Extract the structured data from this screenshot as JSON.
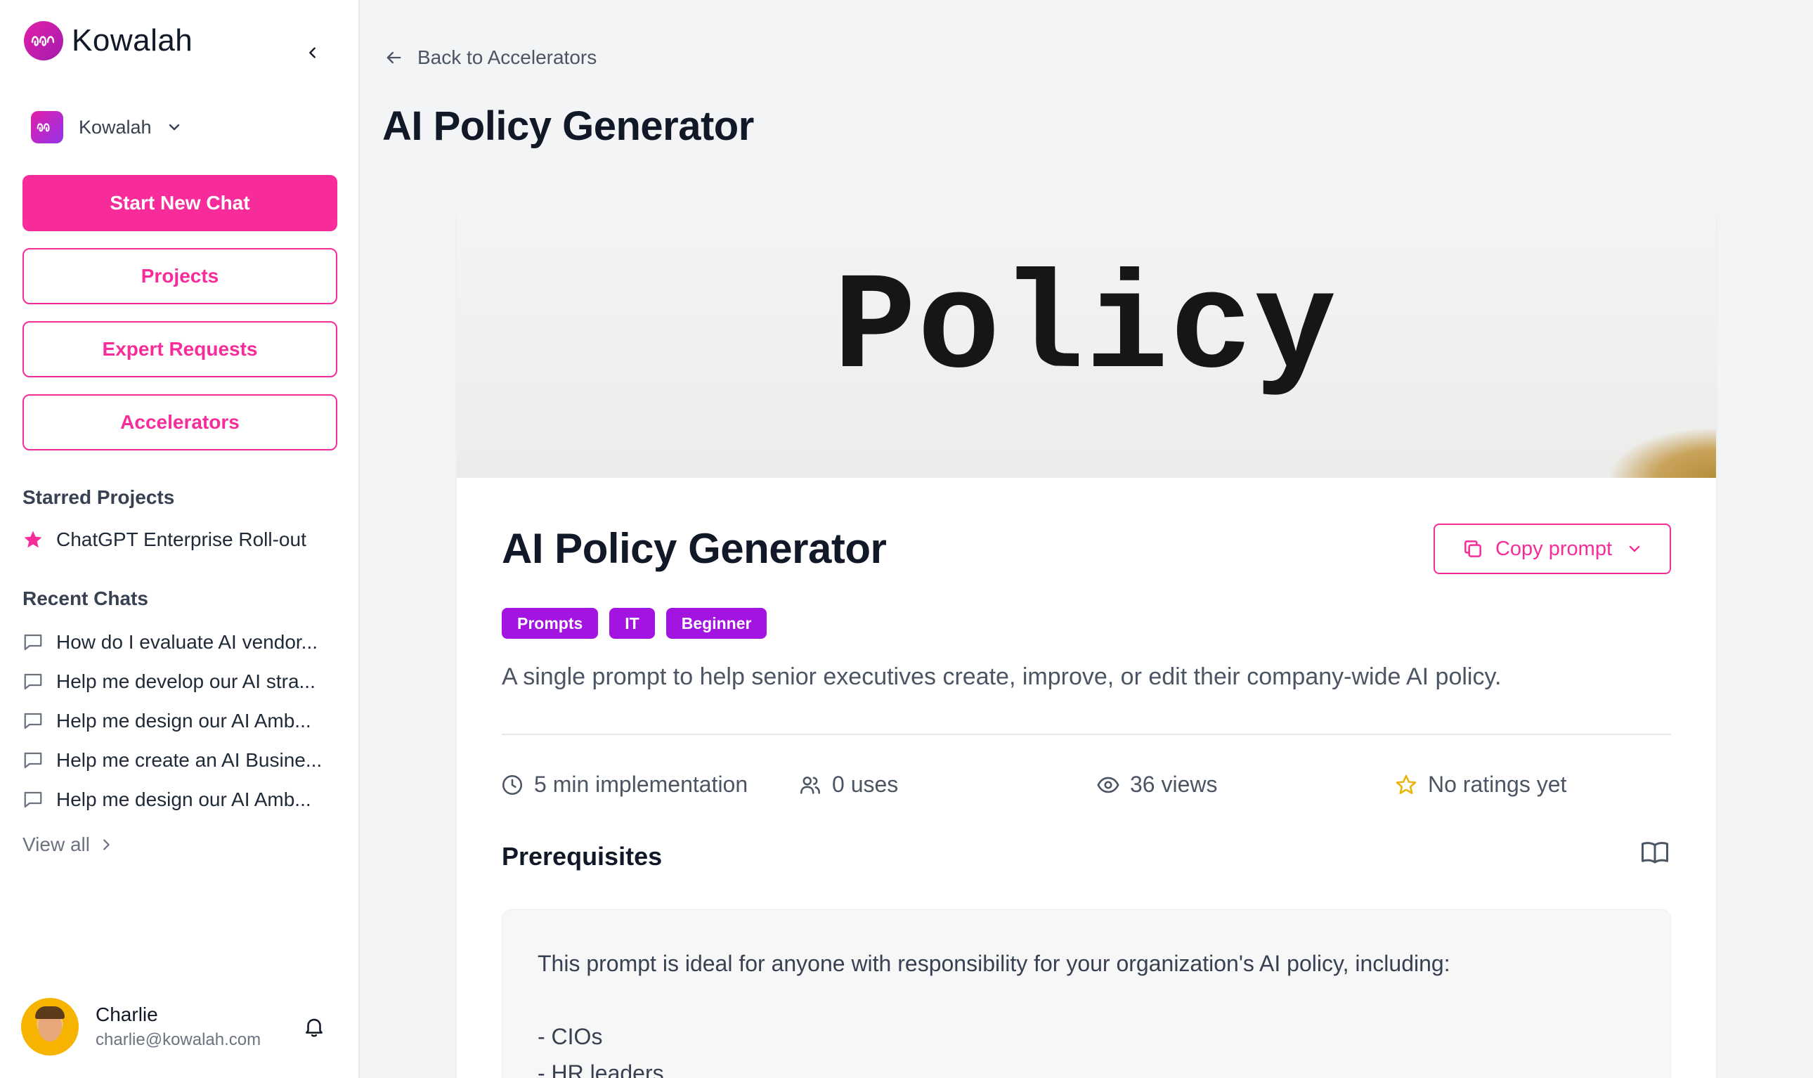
{
  "sidebar": {
    "brand": "Kowalah",
    "org": "Kowalah",
    "buttons": {
      "new_chat": "Start New Chat",
      "projects": "Projects",
      "expert_requests": "Expert Requests",
      "accelerators": "Accelerators"
    },
    "starred_title": "Starred Projects",
    "starred": [
      "ChatGPT Enterprise Roll-out"
    ],
    "recent_title": "Recent Chats",
    "recent": [
      "How do I evaluate AI vendor...",
      "Help me develop our AI stra...",
      "Help me design our AI Amb...",
      "Help me create an AI Busine...",
      "Help me design our AI Amb..."
    ],
    "view_all": "View all",
    "user": {
      "name": "Charlie",
      "email": "charlie@kowalah.com"
    }
  },
  "main": {
    "back_label": "Back to Accelerators",
    "page_title": "AI Policy Generator",
    "hero_word": "Policy",
    "card": {
      "title": "AI Policy Generator",
      "copy_label": "Copy prompt",
      "tags": [
        "Prompts",
        "IT",
        "Beginner"
      ],
      "description": "A single prompt to help senior executives create, improve, or edit their company-wide AI policy.",
      "stats": {
        "implementation": "5 min implementation",
        "uses": "0 uses",
        "views": "36 views",
        "rating": "No ratings yet"
      },
      "prereq_title": "Prerequisites",
      "prereq_text": "This prompt is ideal for anyone with responsibility for your organization's AI policy, including:\n\n- CIOs\n- HR leaders"
    }
  },
  "colors": {
    "accent": "#f72c9a",
    "tag": "#a314e0",
    "star": "#eab308"
  }
}
